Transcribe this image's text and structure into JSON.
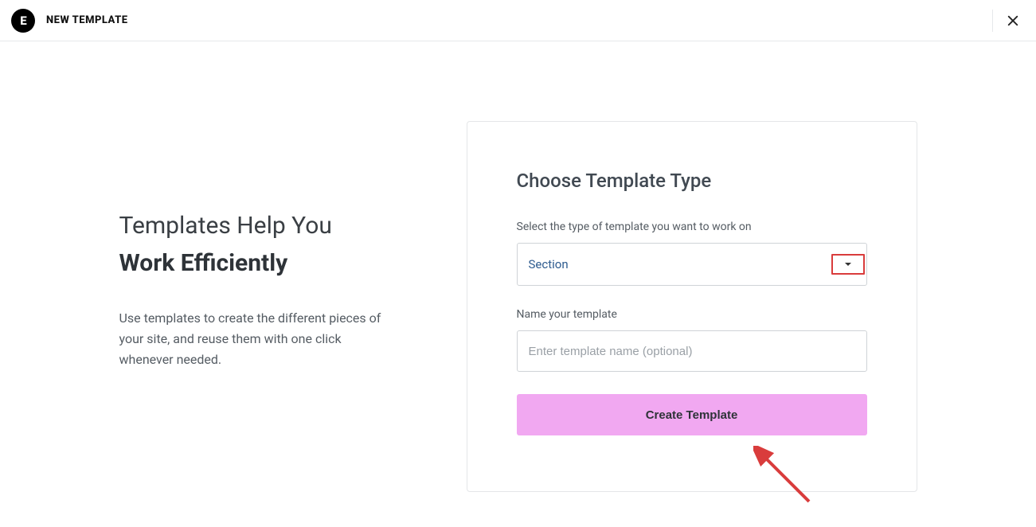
{
  "header": {
    "title": "NEW TEMPLATE",
    "logo_text": "E"
  },
  "intro": {
    "line1": "Templates Help You",
    "line2": "Work Efficiently",
    "body": "Use templates to create the different pieces of your site, and reuse them with one click whenever needed."
  },
  "form": {
    "title": "Choose Template Type",
    "type_label": "Select the type of template you want to work on",
    "type_value": "Section",
    "name_label": "Name your template",
    "name_placeholder": "Enter template name (optional)",
    "name_value": "",
    "create_label": "Create Template"
  }
}
